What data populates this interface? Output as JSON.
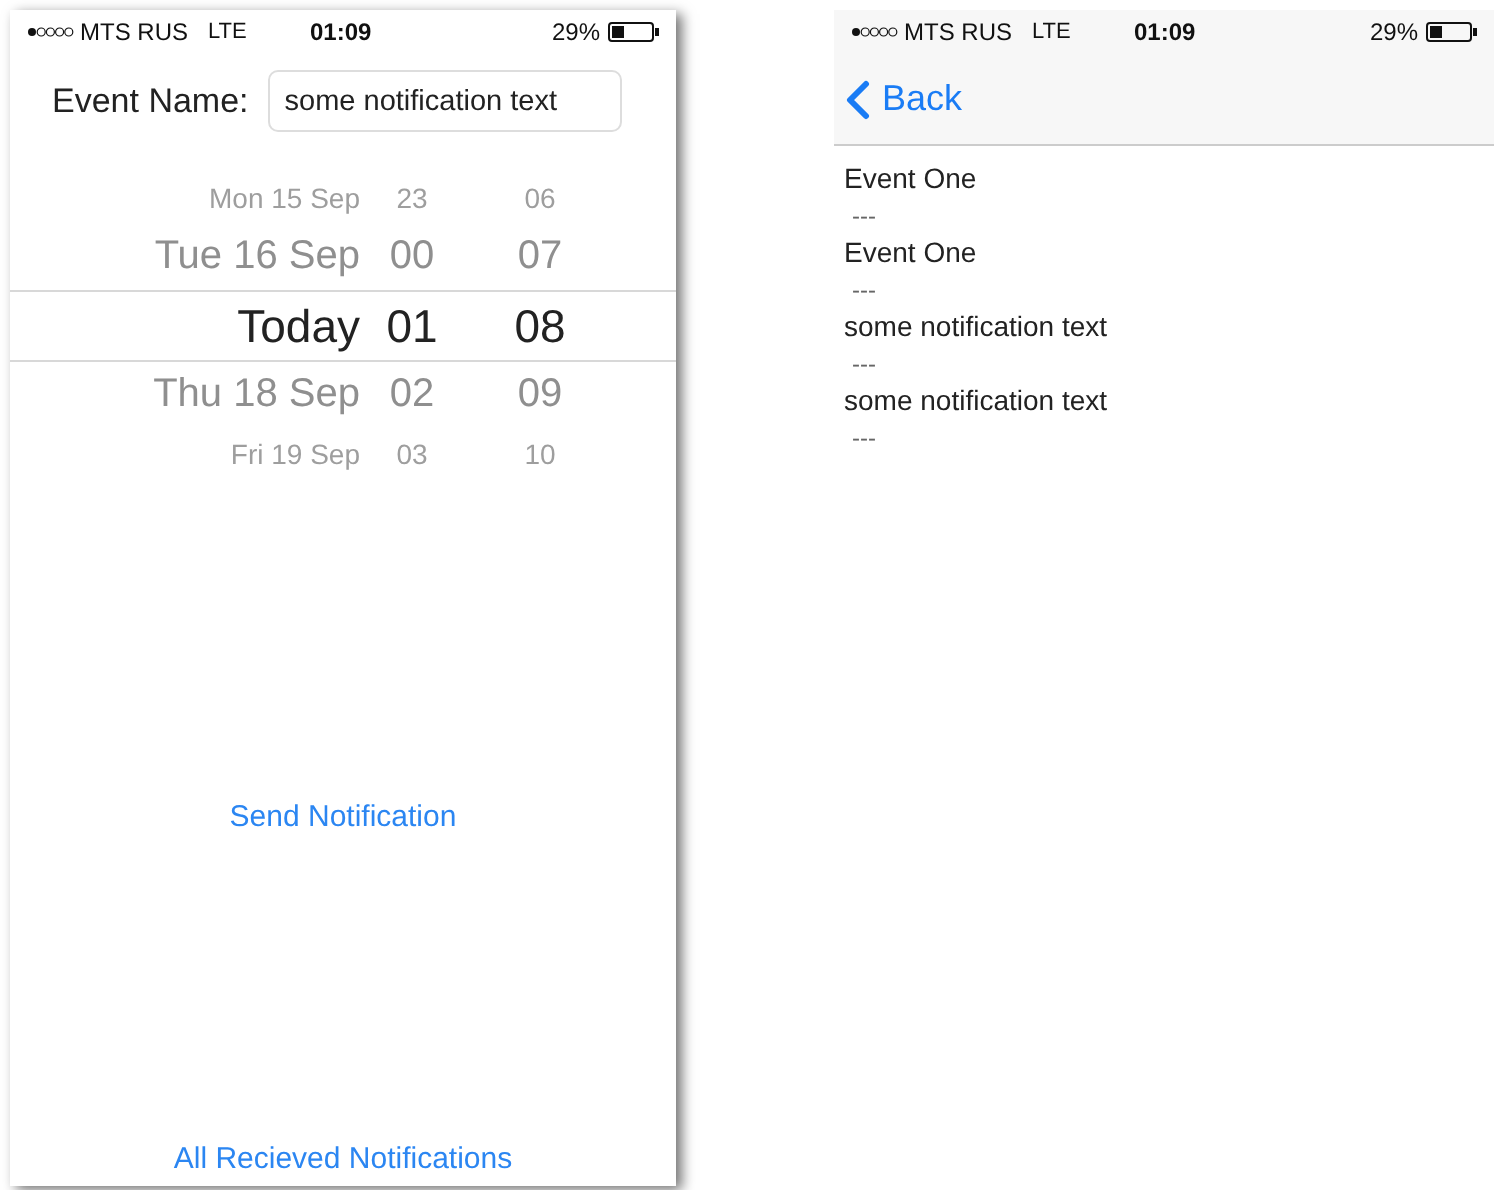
{
  "send_screen": {
    "status_bar": {
      "carrier": "MTS RUS",
      "network": "LTE",
      "time": "01:09",
      "battery": "29%"
    },
    "event_name": {
      "label": "Event Name:",
      "value": "some notification text"
    },
    "picker_rows": [
      {
        "day": "Mon 15 Sep",
        "hour": "23",
        "minute": "06",
        "selected": false
      },
      {
        "day": "Tue 16 Sep",
        "hour": "00",
        "minute": "07",
        "selected": false
      },
      {
        "day": "Today",
        "hour": "01",
        "minute": "08",
        "selected": true
      },
      {
        "day": "Thu 18 Sep",
        "hour": "02",
        "minute": "09",
        "selected": false
      },
      {
        "day": "Fri 19 Sep",
        "hour": "03",
        "minute": "10",
        "selected": false
      }
    ],
    "send_button": "Send Notification",
    "all_button": "All Recieved Notifications"
  },
  "list_screen": {
    "status_bar": {
      "carrier": "MTS RUS",
      "network": "LTE",
      "time": "01:09",
      "battery": "29%"
    },
    "back_button": "Back",
    "notifications": [
      {
        "title": "Event One",
        "detail": "---"
      },
      {
        "title": "Event One",
        "detail": "---"
      },
      {
        "title": "some notification text",
        "detail": "---"
      },
      {
        "title": "some notification text",
        "detail": "---"
      }
    ]
  }
}
